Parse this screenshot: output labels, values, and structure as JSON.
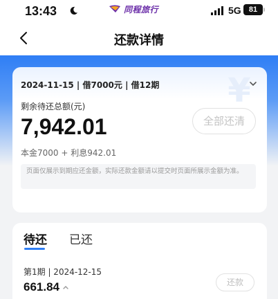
{
  "status_bar": {
    "time": "13:43",
    "brand": "同程旅行",
    "network": "5G",
    "battery": "81"
  },
  "nav": {
    "title": "还款详情"
  },
  "loan": {
    "summary": "2024-11-15 | 借7000元 | 借12期",
    "remaining_label": "剩余待还总额(元)",
    "remaining_amount": "7,942.01",
    "pay_all_label": "全部还清",
    "breakdown": "本金7000 + 利息942.01",
    "notice": "页面仅展示到期应还金额，实际还款金额请以提交时页面所展示金额为准。"
  },
  "tabs": [
    {
      "label": "待还"
    },
    {
      "label": "已还"
    }
  ],
  "installment": {
    "info": "第1期 | 2024-12-15",
    "amount": "661.84",
    "repay_label": "还款"
  },
  "colors": {
    "accent": "#2f7ef5",
    "brand": "#6a2ca8"
  }
}
